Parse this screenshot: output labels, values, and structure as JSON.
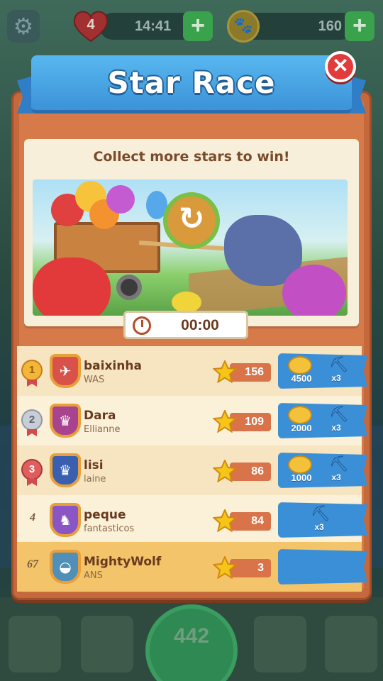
{
  "hud": {
    "lives": "4",
    "lives_timer": "14:41",
    "paw_coins": "160"
  },
  "popup": {
    "title": "Star Race",
    "subtitle": "Collect more stars to win!",
    "timer": "00:00"
  },
  "leaderboard": [
    {
      "rank": "1",
      "rank_style": "gold",
      "name": "baixinha",
      "team": "WAS",
      "stars": "156",
      "badge_color": "#d8524a",
      "badge_icon": "bird-icon",
      "reward_coins": "4500",
      "reward_shovels": "x3"
    },
    {
      "rank": "2",
      "rank_style": "silver",
      "name": "Dara",
      "team": "Ellianne",
      "stars": "109",
      "badge_color": "#a8438f",
      "badge_icon": "crown-icon",
      "reward_coins": "2000",
      "reward_shovels": "x3"
    },
    {
      "rank": "3",
      "rank_style": "bronze",
      "name": "lisi",
      "team": "laine",
      "stars": "86",
      "badge_color": "#3a5fb0",
      "badge_icon": "crown-icon",
      "reward_coins": "1000",
      "reward_shovels": "x3"
    },
    {
      "rank": "4",
      "rank_style": "plain",
      "name": "peque",
      "team": "fantasticos",
      "stars": "84",
      "badge_color": "#8a55c4",
      "badge_icon": "cat-icon",
      "reward_coins": "",
      "reward_shovels": "x3"
    },
    {
      "rank": "67",
      "rank_style": "plain",
      "name": "MightyWolf",
      "team": "ANS",
      "stars": "3",
      "badge_color": "#4f8fb8",
      "badge_icon": "egg-icon",
      "reward_coins": "",
      "reward_shovels": ""
    }
  ],
  "bottom_bar": {
    "level": "442"
  }
}
